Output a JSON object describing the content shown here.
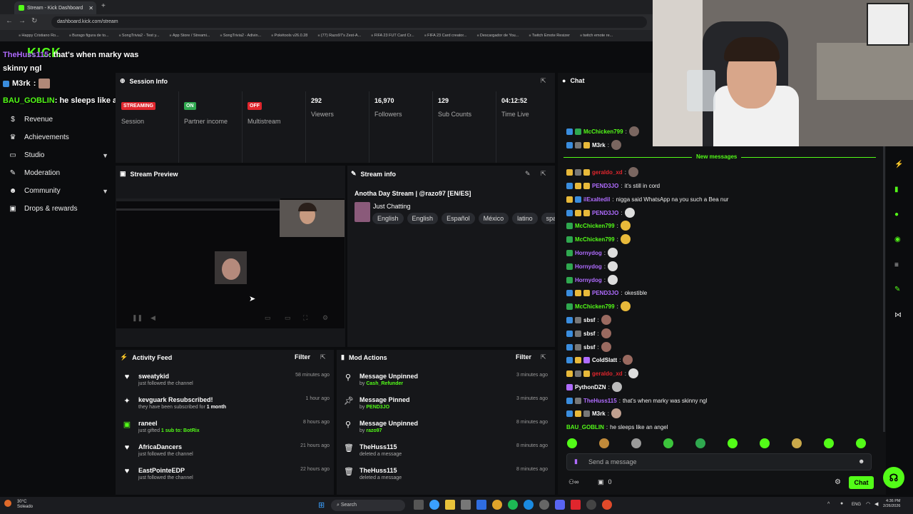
{
  "browser": {
    "tab_title": "Stream - Kick Dashboard",
    "url": "dashboard.kick.com/stream",
    "bookmarks": [
      "Happy Cristiano Ro...",
      "Burago figura de to...",
      "SongTrivia2 - Test y...",
      "App Store / Streami...",
      "SongTrivia2 - Adivin...",
      "Pokétools v26.0.28",
      "(77) Razo97's Zest-A...",
      "FIFA 23 FUT Card Cr...",
      "FIFA 23 Card creator...",
      "Descargador de You...",
      "Twitch Emote Resizer",
      "twitch emote re..."
    ]
  },
  "overlay_chat": [
    {
      "user": "TheHuss115",
      "text": ": that's when marky was skinny ngl"
    },
    {
      "user": "M3rk",
      "text": ":"
    },
    {
      "user": "BAU_GOBLIN",
      "text": ": he sleeps like an angel"
    }
  ],
  "sidebar": {
    "items": [
      {
        "label": "Revenue",
        "icon": "dollar-icon"
      },
      {
        "label": "Achievements",
        "icon": "trophy-icon"
      },
      {
        "label": "Studio",
        "icon": "monitor-icon"
      },
      {
        "label": "Moderation",
        "icon": "wrench-icon"
      },
      {
        "label": "Community",
        "icon": "people-icon"
      },
      {
        "label": "Drops & rewards",
        "icon": "gift-icon"
      }
    ]
  },
  "session": {
    "title": "Session Info",
    "stats": [
      {
        "badge": "STREAMING",
        "badge_color": "#e0262d",
        "label": "Session"
      },
      {
        "badge": "ON",
        "badge_color": "#2fa84f",
        "label": "Partner income"
      },
      {
        "badge": "OFF",
        "badge_color": "#e0262d",
        "label": "Multistream"
      },
      {
        "value": "292",
        "label": "Viewers"
      },
      {
        "value": "16,970",
        "label": "Followers"
      },
      {
        "value": "129",
        "label": "Sub Counts"
      },
      {
        "value": "04:12:52",
        "label": "Time Live"
      }
    ]
  },
  "preview": {
    "title": "Stream Preview"
  },
  "stream_info": {
    "title": "Stream info",
    "stream_title": "Anotha Day Stream | @razo97 [EN/ES]",
    "category": "Just Chatting",
    "tags": [
      "English",
      "English",
      "Español",
      "México",
      "latino",
      "span"
    ]
  },
  "activity": {
    "title": "Activity Feed",
    "filter": "Filter",
    "items": [
      {
        "icon": "heart-icon",
        "name": "sweatykid",
        "sub": "just followed the channel",
        "time": "58 minutes ago"
      },
      {
        "icon": "star-icon",
        "name": "kevguark Resubscribed!",
        "sub": "they have been subscribed for",
        "sub_bold": "1 month",
        "time": "1 hour ago"
      },
      {
        "icon": "gift-icon",
        "name": "raneel",
        "sub": "just gifted",
        "sub_bold": "1 sub to: BotRix",
        "time": "8 hours ago"
      },
      {
        "icon": "heart-icon",
        "name": "AfricaDancers",
        "sub": "just followed the channel",
        "time": "21 hours ago"
      },
      {
        "icon": "heart-icon",
        "name": "EastPointeEDP",
        "sub": "just followed the channel",
        "time": "22 hours ago"
      }
    ]
  },
  "mod_actions": {
    "title": "Mod Actions",
    "filter": "Filter",
    "items": [
      {
        "icon": "unpin-icon",
        "name": "Message Unpinned",
        "by": "by",
        "who": "Cash_Refunder",
        "time": "3 minutes ago"
      },
      {
        "icon": "pin-icon",
        "name": "Message Pinned",
        "by": "by",
        "who": "PEND3JO",
        "time": "3 minutes ago"
      },
      {
        "icon": "unpin-icon",
        "name": "Message Unpinned",
        "by": "by",
        "who": "razo97",
        "time": "8 minutes ago"
      },
      {
        "icon": "trash-icon",
        "name": "TheHuss115",
        "by": "deleted a message",
        "who": "",
        "time": "8 minutes ago"
      },
      {
        "icon": "trash-icon",
        "name": "TheHuss115",
        "by": "deleted a message",
        "who": "",
        "time": "8 minutes ago"
      }
    ]
  },
  "chat": {
    "title": "Chat",
    "new_messages": "New messages",
    "lines": [
      {
        "user": "McChicken799",
        "color": "#53fc18",
        "text": "",
        "emote": "#7a6660"
      },
      {
        "user": "M3rk",
        "color": "#ffffff",
        "text": "",
        "emote": "#7a6660"
      },
      {
        "user": "geraldo_xd",
        "color": "#e0262d",
        "text": "",
        "emote": "#7a6660"
      },
      {
        "user": "PEND3JO",
        "color": "#b06cff",
        "text": "it's still in cord",
        "emote": ""
      },
      {
        "user": "ilExaltedil",
        "color": "#b06cff",
        "text": "nigga said WhatsApp na you such a Bea nur",
        "emote": ""
      },
      {
        "user": "PEND3JO",
        "color": "#b06cff",
        "text": "",
        "emote": "#dddddd"
      },
      {
        "user": "McChicken799",
        "color": "#53fc18",
        "text": "",
        "emote": "#e8b93a"
      },
      {
        "user": "McChicken799",
        "color": "#53fc18",
        "text": "",
        "emote": "#e8b93a"
      },
      {
        "user": "Hornydog",
        "color": "#b06cff",
        "text": "",
        "emote": "#dddddd"
      },
      {
        "user": "Hornydog",
        "color": "#b06cff",
        "text": "",
        "emote": "#dddddd"
      },
      {
        "user": "Hornydog",
        "color": "#b06cff",
        "text": "",
        "emote": "#dddddd"
      },
      {
        "user": "PEND3JO",
        "color": "#b06cff",
        "text": "okestible",
        "emote": ""
      },
      {
        "user": "McChicken799",
        "color": "#53fc18",
        "text": "",
        "emote": "#e8b93a"
      },
      {
        "user": "sbsf",
        "color": "#ffffff",
        "text": "",
        "emote": "#9a6a60"
      },
      {
        "user": "sbsf",
        "color": "#ffffff",
        "text": "",
        "emote": "#9a6a60"
      },
      {
        "user": "sbsf",
        "color": "#ffffff",
        "text": "",
        "emote": "#9a6a60"
      },
      {
        "user": "ColdSlatt",
        "color": "#ffffff",
        "text": "",
        "emote": "#9a6a60"
      },
      {
        "user": "geraldo_xd",
        "color": "#e0262d",
        "text": "",
        "emote": "#dddddd"
      },
      {
        "user": "PythonDZN",
        "color": "#ffffff",
        "text": "",
        "emote": "#bbbbbb"
      },
      {
        "user": "TheHuss115",
        "color": "#b06cff",
        "text": "that's when marky was skinny ngl",
        "emote": ""
      },
      {
        "user": "M3rk",
        "color": "#ffffff",
        "text": "",
        "emote": "#c0a090"
      },
      {
        "user": "BAU_GOBLIN",
        "color": "#53fc18",
        "text": "he sleeps like an angel",
        "emote": ""
      }
    ],
    "placeholder": "Send a message",
    "viewers": "0",
    "pinned": "0",
    "send_label": "Chat"
  },
  "taskbar": {
    "weather_temp": "30°C",
    "weather_desc": "Soleado",
    "search": "Search",
    "lang": "ENG",
    "time": "4:36 PM",
    "date": "2/26/2026"
  },
  "colors": {
    "accent": "#53fc18",
    "live_red": "#e0262d"
  }
}
